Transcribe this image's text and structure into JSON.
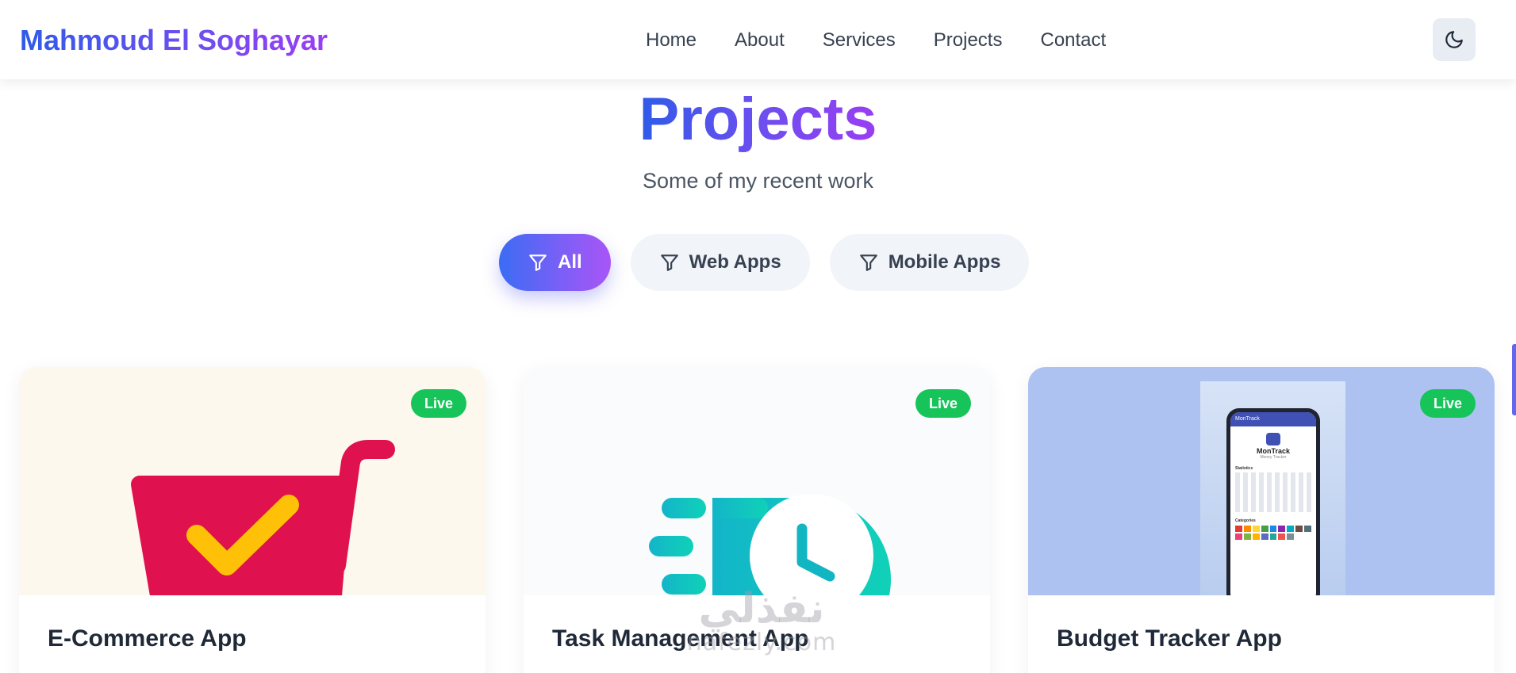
{
  "header": {
    "brand": "Mahmoud El Soghayar",
    "nav": [
      "Home",
      "About",
      "Services",
      "Projects",
      "Contact"
    ],
    "theme_toggle_icon": "moon-icon"
  },
  "section": {
    "title": "Projects",
    "subtitle": "Some of my recent work"
  },
  "filters": [
    {
      "label": "All",
      "active": true,
      "icon": "filter-icon"
    },
    {
      "label": "Web Apps",
      "active": false,
      "icon": "filter-icon"
    },
    {
      "label": "Mobile Apps",
      "active": false,
      "icon": "filter-icon"
    }
  ],
  "projects": [
    {
      "title": "E-Commerce App",
      "badge": "Live",
      "image": "shopping-cart-check-logo"
    },
    {
      "title": "Task Management App",
      "badge": "Live",
      "image": "fast-clock-logo"
    },
    {
      "title": "Budget Tracker App",
      "badge": "Live",
      "image": "phone-mockup-montrack",
      "phone": {
        "header": "MonTrack",
        "app_name": "MonTrack",
        "tagline": "Money Tracker",
        "section1": "Statistics",
        "section2": "Categories"
      }
    }
  ],
  "watermark": {
    "arabic": "نفذلي",
    "latin": "nafezly.com"
  },
  "colors": {
    "brand_gradient_start": "#2f5be8",
    "brand_gradient_end": "#9a3df2",
    "live_badge": "#16c45a",
    "cart_red": "#e0114f",
    "check_yellow": "#ffc107",
    "clock_teal": "#12bfc2"
  }
}
